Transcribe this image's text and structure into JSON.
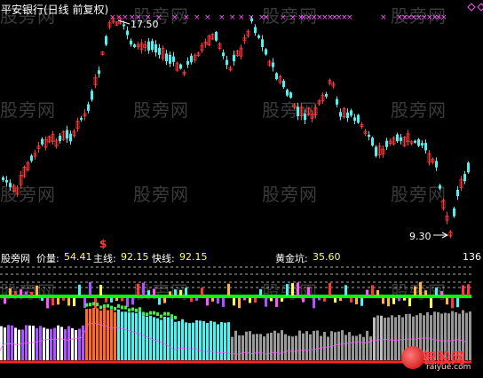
{
  "title": "平安银行(日线 前复权)",
  "watermark": "股旁网",
  "price_labels": {
    "high": "17.50",
    "low": "9.30"
  },
  "marker_symbol": "$",
  "indicator_bar": {
    "name": "股旁网",
    "price_label": "价量:",
    "price_value": "54.41",
    "main_label": "主线:",
    "main_value": "92.15",
    "fast_label": "快线:",
    "fast_value": "92.15",
    "gold_label": "黄金坑:",
    "gold_value": "35.60",
    "count_value": "136"
  },
  "logo": {
    "text": "智股网",
    "url": "raiyue.com"
  },
  "colors": {
    "up": "#ff3a3a",
    "down": "#54f0f0",
    "dashed": "#aaaaaa",
    "signal": "#ff55ff",
    "zero_line": "#00ff00",
    "gold": "#ffff55"
  }
}
